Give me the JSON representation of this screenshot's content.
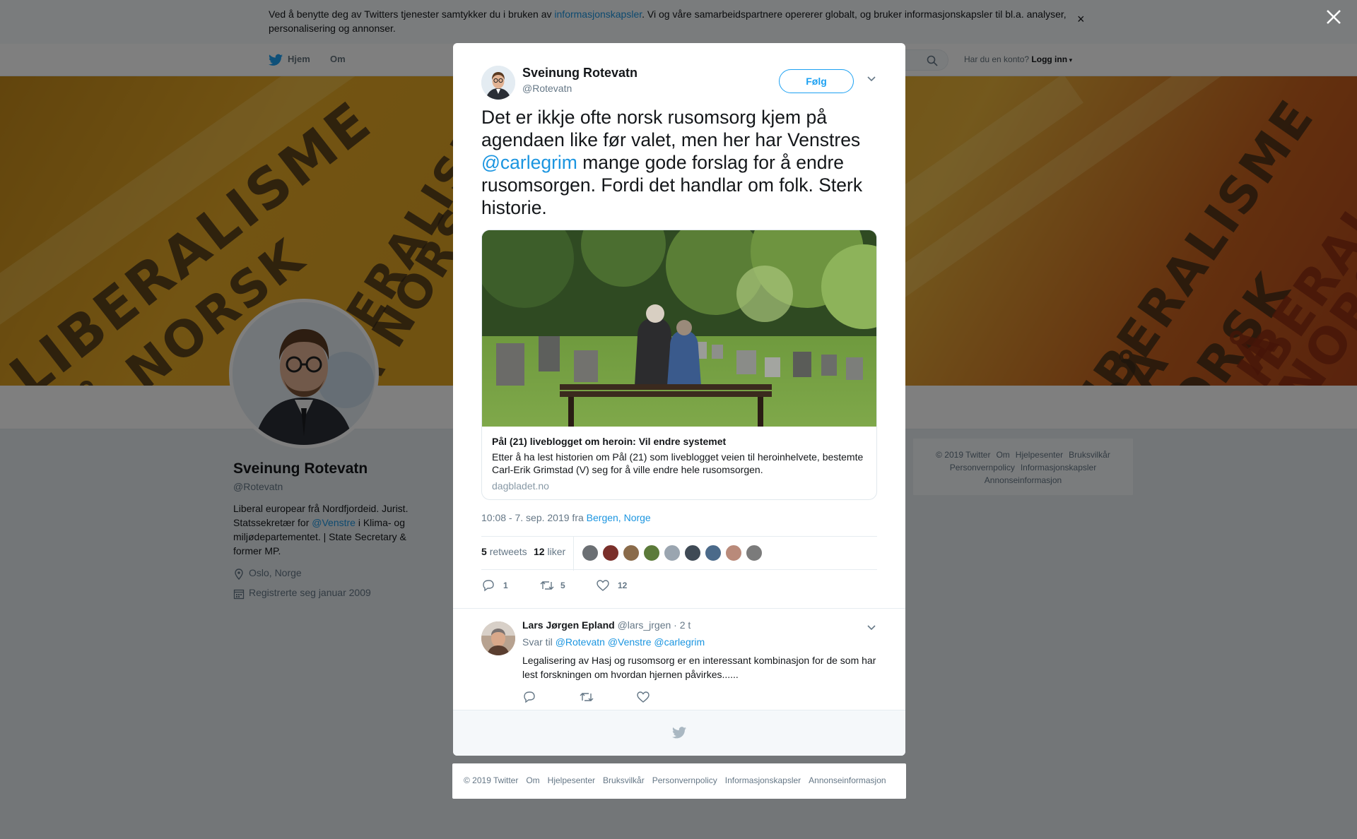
{
  "cookie_banner": {
    "text_before": "Ved å benytte deg av Twitters tjenester samtykker du i bruken av ",
    "link": "informasjonskapsler",
    "text_after": ". Vi og våre samarbeidspartnere opererer globalt, og bruker informasjonskapsler til bl.a. analyser, personalisering og annonser.",
    "close": "×"
  },
  "nav": {
    "home": "Hjem",
    "about": "Om",
    "account_prompt": "Har du en konto?",
    "login": "Logg inn"
  },
  "banner": {
    "words": [
      "LIBERALISME",
      "PÅ NORSK",
      "LIBERALISME",
      "PÅ NORSK",
      "LIBERALISME",
      "PÅ NORSK",
      "LIBERALISME",
      "Å NORSK"
    ]
  },
  "profile": {
    "name": "Sveinung Rotevatn",
    "handle": "@Rotevatn",
    "bio_1": "Liberal europear frå Nordfjordeid. Jurist. Statssekretær for ",
    "bio_mention": "@Venstre",
    "bio_2": " i Klima- og miljødepartementet. | State Secretary & former MP.",
    "location": "Oslo, Norge",
    "joined": "Registrerte seg januar 2009"
  },
  "side_footer": {
    "links": [
      "© 2019 Twitter",
      "Om",
      "Hjelpesenter",
      "Bruksvilkår",
      "Personvernpolicy",
      "Informasjonskapsler",
      "Annonseinformasjon"
    ]
  },
  "tweet": {
    "author_name": "Sveinung Rotevatn",
    "author_handle": "@Rotevatn",
    "follow_label": "Følg",
    "text_1": "Det er ikkje ofte norsk rusomsorg kjem på agendaen like før valet, men her har Venstres ",
    "text_mention": "@carlegrim",
    "text_2": " mange gode forslag for å endre rusomsorgen. Fordi det handlar om folk. Sterk historie.",
    "card": {
      "title": "Pål (21) liveblogget om heroin: Vil endre systemet",
      "description": "Etter å ha lest historien om Pål (21) som liveblogget veien til heroinhelvete, bestemte Carl-Erik Grimstad (V) seg for å ville endre hele rusomsorgen.",
      "domain": "dagbladet.no"
    },
    "timestamp": "10:08 - 7. sep. 2019 fra ",
    "location": "Bergen, Norge",
    "retweets_count": "5",
    "retweets_label": "retweets",
    "likes_count": "12",
    "likes_label": "liker",
    "likers_colors": [
      "#6b6f73",
      "#7a2f2a",
      "#8a6b4a",
      "#5b7a3a",
      "#9aa5b0",
      "#3f4a55",
      "#4b6a8a",
      "#b98a7a",
      "#7b7b7b"
    ],
    "actions": {
      "replies": "1",
      "retweets": "5",
      "likes": "12"
    }
  },
  "reply": {
    "name": "Lars Jørgen Epland",
    "handle": "@lars_jrgen",
    "time": "· 2 t",
    "reply_to_label": "Svar til",
    "mentions": "@Rotevatn @Venstre @carlegrim",
    "text": "Legalisering av Hasj og rusomsorg er en interessant kombinasjon for de som har lest forskningen om hvordan hjernen påvirkes......"
  },
  "bottom_footer": {
    "links": [
      "© 2019 Twitter",
      "Om",
      "Hjelpesenter",
      "Bruksvilkår",
      "Personvernpolicy",
      "Informasjonskapsler",
      "Annonseinformasjon"
    ]
  },
  "colors": {
    "twitter_blue": "#1da1f2",
    "link_blue": "#1b95e0",
    "text_gray": "#657786"
  }
}
